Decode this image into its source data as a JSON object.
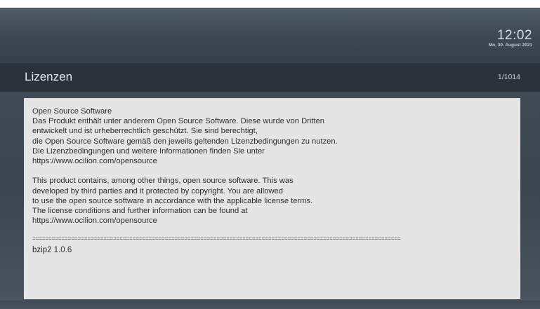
{
  "status_bar": {
    "time": "12:02",
    "date": "Mo, 30. August 2021"
  },
  "header": {
    "title": "Lizenzen",
    "page_indicator": "1/1014"
  },
  "license_text": {
    "german_lines": [
      "Open Source Software",
      "Das Produkt enthält unter anderem Open Source Software. Diese wurde von Dritten",
      "entwickelt und ist urheberrechtlich geschützt. Sie sind berechtigt,",
      "die Open Source Software gemäß den jeweils geltenden Lizenzbedingungen zu nutzen.",
      "Die Lizenzbedingungen und weitere Informationen finden Sie unter",
      "https://www.ocilion.com/opensource"
    ],
    "english_lines": [
      "This product contains, among other things, open source software. This was",
      "developed by third parties and it protected by copyright. You are allowed",
      "to use the open source software in accordance with the applicable license terms.",
      "The license conditions and further information can be found at",
      "https://www.ocilion.com/opensource"
    ],
    "separator": "==================================================================================================================",
    "package": "bzip2 1.0.6"
  },
  "colors": {
    "header_bar": "#2a333c",
    "panel_background": "#e5e5e5",
    "text": "#2c2c2c"
  }
}
